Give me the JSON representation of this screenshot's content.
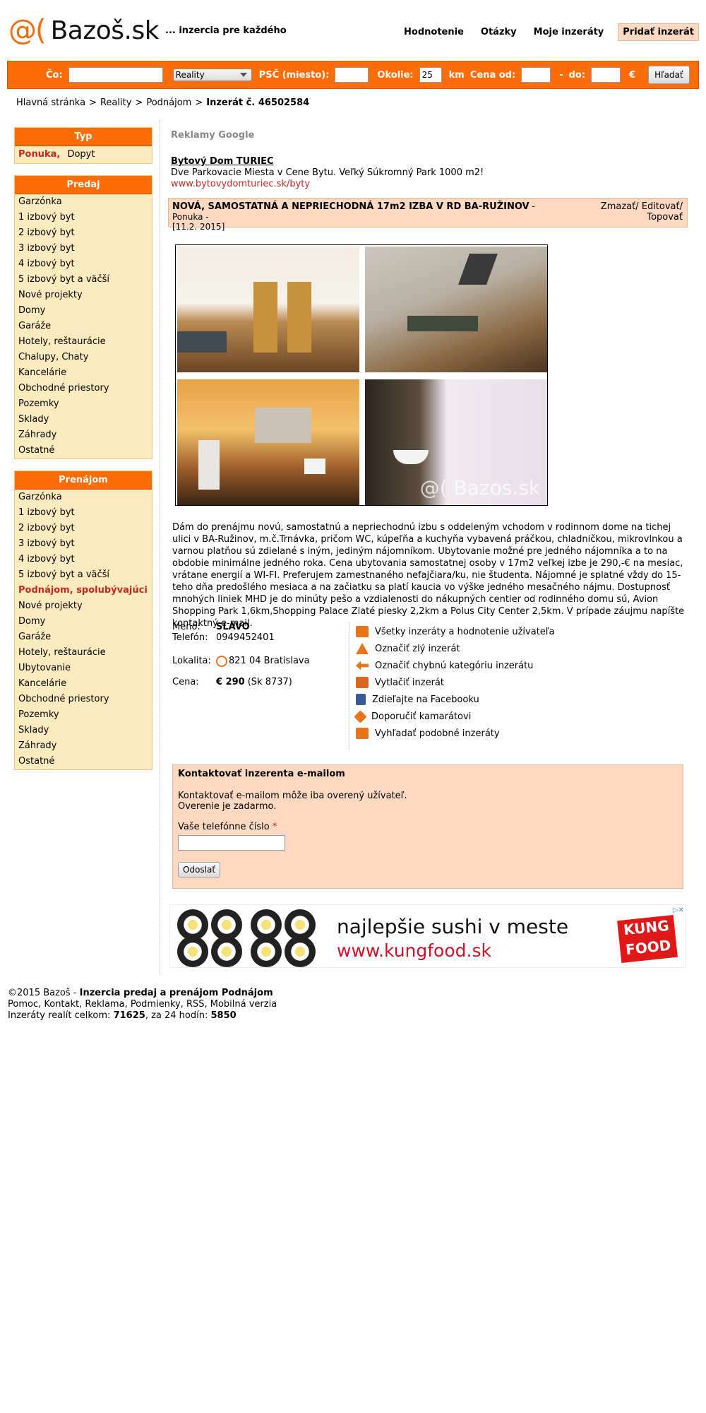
{
  "header": {
    "logo_at": "@(",
    "logo_text": "Bazoš.sk",
    "tagline": "... inzercia pre každého",
    "nav": [
      "Hodnotenie",
      "Otázky",
      "Moje inzeráty"
    ],
    "add_label": "Pridať inzerát"
  },
  "search": {
    "co_label": "Čo:",
    "category_value": "Reality",
    "psc_label": "PSČ (miesto):",
    "okolie_label": "Okolie:",
    "okolie_value": "25",
    "km_label": "km",
    "cena_od_label": "Cena od:",
    "dash": "-",
    "do_label": "do:",
    "currency": "€",
    "button": "Hľadať"
  },
  "breadcrumb": {
    "items": [
      "Hlavná stránka",
      "Reality",
      "Podnájom"
    ],
    "current": "Inzerát č. 46502584",
    "sep": ">"
  },
  "sidebar": {
    "typ": {
      "title": "Typ",
      "on": "Ponuka,",
      "off": "Dopyt"
    },
    "predaj": {
      "title": "Predaj",
      "items": [
        "Garzónka",
        "1 izbový byt",
        "2 izbový byt",
        "3 izbový byt",
        "4 izbový byt",
        "5 izbový byt a väčší",
        "Nové projekty",
        "Domy",
        "Garáže",
        "Hotely, reštaurácie",
        "Chalupy, Chaty",
        "Kancelárie",
        "Obchodné priestory",
        "Pozemky",
        "Sklady",
        "Záhrady",
        "Ostatné"
      ]
    },
    "prenajom": {
      "title": "Prenájom",
      "items": [
        "Garzónka",
        "1 izbový byt",
        "2 izbový byt",
        "3 izbový byt",
        "4 izbový byt",
        "5 izbový byt a väčší",
        "Podnájom, spolubývajúci",
        "Nové projekty",
        "Domy",
        "Garáže",
        "Hotely, reštaurácie",
        "Ubytovanie",
        "Kancelárie",
        "Obchodné priestory",
        "Pozemky",
        "Sklady",
        "Záhrady",
        "Ostatné"
      ],
      "active_index": 6
    }
  },
  "ads": {
    "label": "Reklamy Google",
    "title": "Bytový Dom TURIEC",
    "desc": "Dve Parkovacie Miesta v Cene Bytu. Veľký Súkromný Park 1000 m2!",
    "url": "www.bytovydomturiec.sk/byty"
  },
  "listing": {
    "title": "NOVÁ, SAMOSTATNÁ A NEPRIECHODNÁ 17m2 IZBA V RD BA-RUŽINOV",
    "type": " - Ponuka -",
    "date": "[11.2. 2015]",
    "actions_line1": "Zmazať/ Editovať/",
    "actions_line2": "Topovať",
    "watermark": "@( Bazos.sk",
    "description": "Dám do prenájmu novú, samostatnú a nepriechodnú izbu s oddeleným vchodom v rodinnom dome na tichej ulici v BA-Ružinov, m.č.Trnávka, pričom WC, kúpeľňa a kuchyňa vybavená práčkou, chladničkou, mikrovlnkou a varnou platňou sú zdielané s iným, jediným nájomníkom. Ubytovanie možné pre jedného nájomníka a to na obdobie minimálne jedného roka. Cena ubytovania samostatnej osoby v 17m2 veľkej izbe je 290,-€ na mesiac, vrátane energií a WI-FI. Preferujem zamestnaného nefajčiara/ku, nie študenta. Nájomné je splatné vždy do 15-teho dňa predošlého mesiaca a na začiatku sa platí kaucia vo výške jedného mesačného nájmu. Dostupnosť mnohých liniek MHD je do minúty pešo a vzdialenosti do nákupných centier od rodinného domu sú, Avion Shopping Park 1,6km,Shopping Palace Zlaté piesky 2,2km a Polus City Center 2,5km. V prípade záujmu napíšte kontaktný e-mail."
  },
  "seller": {
    "meno_label": "Meno:",
    "meno": "SLAVO",
    "tel_label": "Telefón:",
    "tel": "0949452401",
    "lokalita_label": "Lokalita:",
    "lokalita": "821 04 Bratislava",
    "cena_label": "Cena:",
    "cena": "€ 290",
    "cena_sk": "(Sk 8737)"
  },
  "actions": [
    {
      "label": "Všetky inzeráty a hodnotenie užívateľa",
      "icon": "user-ratings-icon",
      "color": "#e8741c"
    },
    {
      "label": "Označiť zlý inzerát",
      "icon": "warning-icon",
      "color": "#e8741c"
    },
    {
      "label": "Označiť chybnú kategóriu inzerátu",
      "icon": "swap-arrows-icon",
      "color": "#e8741c"
    },
    {
      "label": "Vytlačiť inzerát",
      "icon": "printer-icon",
      "color": "#d9681f"
    },
    {
      "label": "Zdieľajte na Facebooku",
      "icon": "facebook-icon",
      "color": "#3b5998"
    },
    {
      "label": "Doporučiť kamarátovi",
      "icon": "recommend-icon",
      "color": "#e8741c"
    },
    {
      "label": "Vyhľadať podobné inzeráty",
      "icon": "sitemap-icon",
      "color": "#e8741c"
    }
  ],
  "contact": {
    "title": "Kontaktovať inzerenta e-mailom",
    "line1": "Kontaktovať e-mailom môže iba overený užívateľ.",
    "line2": "Overenie je zadarmo.",
    "phone_label": "Vaše telefónne číslo",
    "required": "*",
    "button": "Odoslať"
  },
  "banner": {
    "line1": "najlepšie sushi v meste",
    "line2": "www.kungfood.sk",
    "brand": "KUNG FOOD"
  },
  "footer": {
    "copyright": "©2015 Bazoš -",
    "copyright_bold": "Inzercia predaj a prenájom Podnájom",
    "links": "Pomoc, Kontakt, Reklama, Podmienky, RSS, Mobilná verzia",
    "stats_prefix": "Inzeráty realít celkom:",
    "total": "71625",
    "stats_mid": ", za 24 hodín:",
    "day": "5850"
  },
  "colors": {
    "accent": "#ff6d08",
    "sidebar_bg": "#fdebc0",
    "highlight_bg": "#fdd9c1",
    "link_red": "#c8281e"
  }
}
